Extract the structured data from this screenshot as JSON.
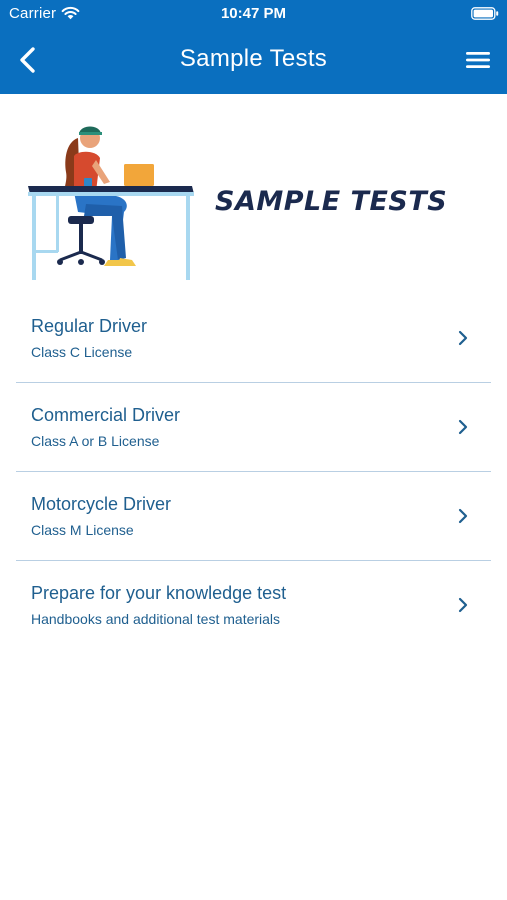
{
  "status_bar": {
    "carrier": "Carrier",
    "time": "10:47 PM",
    "icons": [
      "wifi-icon",
      "battery-icon"
    ]
  },
  "nav": {
    "title": "Sample Tests",
    "back_icon": "chevron-left-icon",
    "menu_icon": "hamburger-menu-icon"
  },
  "hero": {
    "heading": "SAMPLE TESTS",
    "illustration": "woman-at-desk-illustration"
  },
  "list": {
    "items": [
      {
        "title": "Regular Driver",
        "subtitle": "Class C License"
      },
      {
        "title": "Commercial Driver",
        "subtitle": "Class A or B License"
      },
      {
        "title": "Motorcycle Driver",
        "subtitle": "Class M License"
      },
      {
        "title": "Prepare for your knowledge test",
        "subtitle": "Handbooks and additional test materials"
      }
    ]
  },
  "colors": {
    "header_blue": "#0a6fbf",
    "heading_navy": "#1b2a4e",
    "link_blue": "#1f5f8f",
    "divider": "#b9cfe3"
  }
}
